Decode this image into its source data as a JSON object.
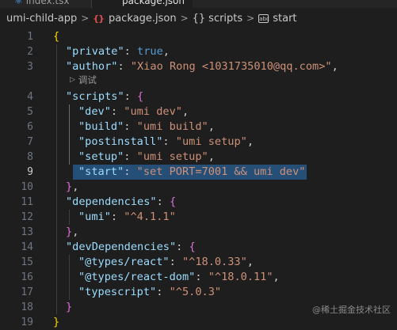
{
  "tabs": {
    "left": "index.tsx",
    "active": "package.json"
  },
  "breadcrumb": {
    "folder": "umi-child-app",
    "file_icon": "json-file-icon",
    "file": "package.json",
    "section": "scripts",
    "item": "start"
  },
  "codelens": {
    "label": "调试"
  },
  "editor": {
    "active_line": 9,
    "line_numbers": [
      "1",
      "2",
      "3",
      "4",
      "5",
      "6",
      "7",
      "8",
      "9",
      "10",
      "11",
      "12",
      "13",
      "14",
      "15",
      "16",
      "17",
      "18",
      "19"
    ],
    "tokens": {
      "l1_open": "{",
      "l2_key": "\"private\"",
      "l2_colon": ": ",
      "l2_val": "true",
      "l2_comma": ",",
      "l3_key": "\"author\"",
      "l3_colon": ": ",
      "l3_val": "\"Xiao Rong <1031735010@qq.com>\"",
      "l3_comma": ",",
      "l4_key": "\"scripts\"",
      "l4_colon": ": ",
      "l4_open": "{",
      "l5_key": "\"dev\"",
      "l5_colon": ": ",
      "l5_val": "\"umi dev\"",
      "l5_comma": ",",
      "l6_key": "\"build\"",
      "l6_colon": ": ",
      "l6_val": "\"umi build\"",
      "l6_comma": ",",
      "l7_key": "\"postinstall\"",
      "l7_colon": ": ",
      "l7_val": "\"umi setup\"",
      "l7_comma": ",",
      "l8_key": "\"setup\"",
      "l8_colon": ": ",
      "l8_val": "\"umi setup\"",
      "l8_comma": ",",
      "l9_key": "\"start\"",
      "l9_colon": ": ",
      "l9_val": "\"set PORT=7001 && umi dev\"",
      "l10_close": "}",
      "l10_comma": ",",
      "l11_key": "\"dependencies\"",
      "l11_colon": ": ",
      "l11_open": "{",
      "l12_key": "\"umi\"",
      "l12_colon": ": ",
      "l12_val": "\"^4.1.1\"",
      "l13_close": "}",
      "l13_comma": ",",
      "l14_key": "\"devDependencies\"",
      "l14_colon": ": ",
      "l14_open": "{",
      "l15_key": "\"@types/react\"",
      "l15_colon": ": ",
      "l15_val": "\"^18.0.33\"",
      "l15_comma": ",",
      "l16_key": "\"@types/react-dom\"",
      "l16_colon": ": ",
      "l16_val": "\"^18.0.11\"",
      "l16_comma": ",",
      "l17_key": "\"typescript\"",
      "l17_colon": ": ",
      "l17_val": "\"^5.0.3\"",
      "l18_close": "}",
      "l19_close": "}"
    }
  },
  "watermark": "@稀土掘金技术社区",
  "colors": {
    "background": "#1e1e1e",
    "key": "#9cdcfe",
    "string": "#ce9178",
    "boolean": "#569cd6",
    "bracket_level1": "#ffd700",
    "bracket_level2": "#da70d6",
    "bracket_level3": "#179fff",
    "selection": "#264f78",
    "json_icon": "#e34b4b"
  }
}
